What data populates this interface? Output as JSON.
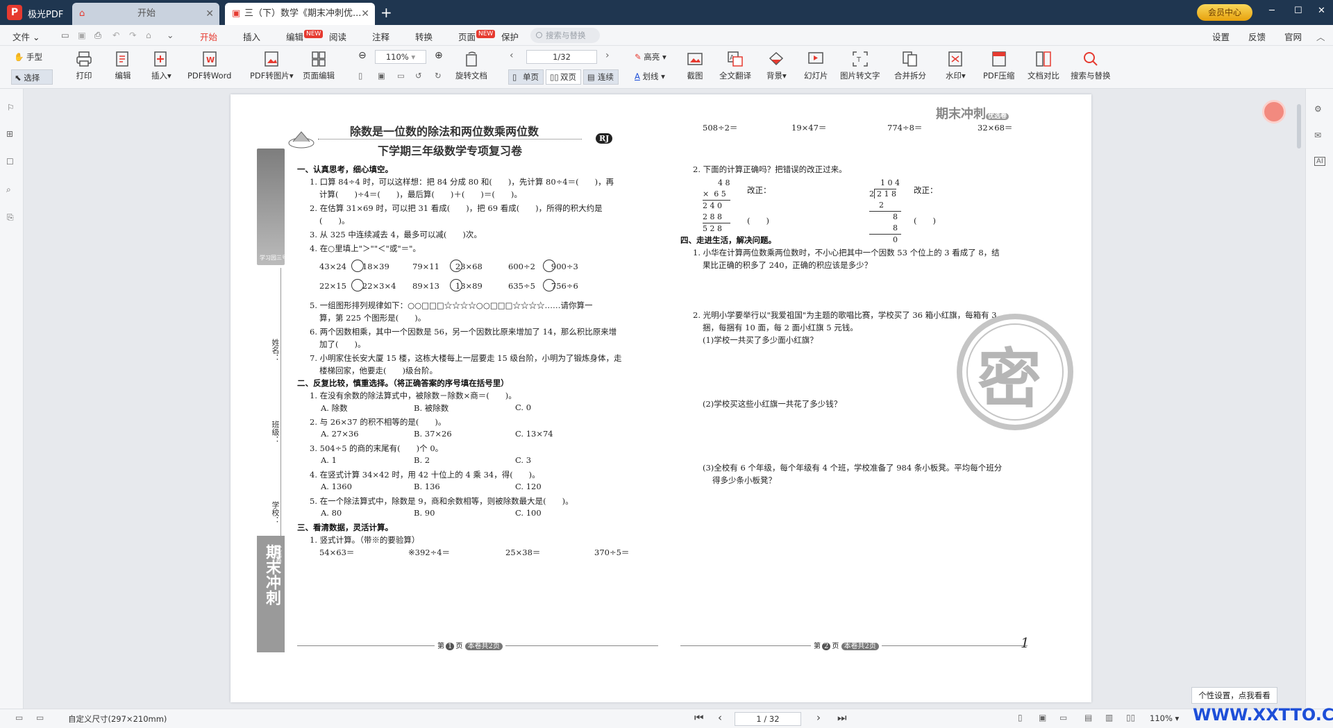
{
  "titlebar": {
    "app_name": "极光PDF",
    "tabs": [
      {
        "label": "开始"
      },
      {
        "label": "三（下）数学《期末冲刺优..."
      }
    ],
    "vip_label": "会员中心"
  },
  "menu": {
    "file": "文件",
    "items": [
      "开始",
      "插入",
      "编辑",
      "阅读",
      "注释",
      "转换",
      "页面",
      "保护"
    ],
    "new_badge": "NEW",
    "search_placeholder": "搜索与替换",
    "right": [
      "设置",
      "反馈",
      "官网"
    ]
  },
  "toolbar": {
    "hand": "手型",
    "select": "选择",
    "print": "打印",
    "edit": "编辑",
    "insert": "插入",
    "pdf2word": "PDF转Word",
    "pdf2img": "PDF转图片",
    "page_edit": "页面编辑",
    "zoom": "110%",
    "rotate": "旋转文档",
    "page": "1/32",
    "single": "单页",
    "double": "双页",
    "continuous": "连续",
    "highlight": "高亮",
    "underline": "划线",
    "screenshot": "截图",
    "translate": "全文翻译",
    "background": "背景",
    "slides": "幻灯片",
    "img2text": "图片转文字",
    "merge": "合并拆分",
    "watermark": "水印",
    "compress": "PDF压缩",
    "compare": "文档对比",
    "search_replace": "搜索与替换"
  },
  "doc": {
    "title1": "除数是一位数的除法和两位数乘两位数",
    "title2": "下学期三年级数学专项复习卷",
    "badge": "RJ",
    "brand_top": "期末冲刺",
    "brand_sub": "优选卷",
    "side_label": "学习园三号",
    "side_name": "姓名：",
    "side_class": "班级：",
    "side_school": "学校：",
    "left": [
      "一、认真思考，细心填空。",
      "1. 口算 84÷4 时，可以这样想：把 84 分成 80 和(　　)，先计算 80÷4＝(　　)，再",
      "计算(　　)÷4＝(　　)，最后算(　　)＋(　　)＝(　　)。",
      "2. 在估算 31×69 时，可以把 31 看成(　　)，把 69 看成(　　)，所得的积大约是",
      "(　　)。",
      "3. 从 325 中连续减去 4，最多可以减(　　)次。",
      "4. 在○里填上\"＞\"\"＜\"或\"＝\"。",
      "43×24　　18×39",
      "79×11　　23×68",
      "600÷2　　900÷3",
      "22×15　　22×3×4",
      "89×13　　13×89",
      "635÷5　　756÷6",
      "5. 一组图形排列规律如下：○○□□□☆☆☆☆○○□□□☆☆☆☆……请你算一",
      "算，第 225 个图形是(　　)。",
      "6. 两个因数相乘，其中一个因数是 56，另一个因数比原来增加了 14，那么积比原来增",
      "加了(　　)。",
      "7. 小明家住长安大厦 15 楼，这栋大楼每上一层要走 15 级台阶，小明为了锻炼身体，走",
      "楼梯回家，他要走(　　)级台阶。",
      "二、反复比较，慎重选择。（将正确答案的序号填在括号里）",
      "1. 在没有余数的除法算式中，被除数－除数×商＝(　　)。",
      "A. 除数",
      "B. 被除数",
      "C. 0",
      "2. 与 26×37 的积不相等的是(　　)。",
      "A. 27×36",
      "B. 37×26",
      "C. 13×74",
      "3. 504÷5 的商的末尾有(　　)个 0。",
      "A. 1",
      "B. 2",
      "C. 3",
      "4. 在竖式计算 34×42 时，用 42 十位上的 4 乘 34，得(　　)。",
      "A. 1360",
      "B. 136",
      "C. 120",
      "5. 在一个除法算式中，除数是 9，商和余数相等，则被除数最大是(　　)。",
      "A. 80",
      "B. 90",
      "C. 100",
      "三、看清数据，灵活计算。",
      "1. 竖式计算。（带※的要验算）",
      "54×63＝",
      "※392÷4＝",
      "25×38＝",
      "370÷5＝"
    ],
    "right": [
      "508÷2＝",
      "19×47＝",
      "774÷8＝",
      "32×68＝",
      "2. 下面的计算正确吗？把错误的改正过来。",
      "改正：",
      "改正：",
      "(　　)",
      "(　　)",
      "四、走进生活，解决问题。",
      "1. 小华在计算两位数乘两位数时，不小心把其中一个因数 53 个位上的 3 看成了 8，结",
      "果比正确的积多了 240，正确的积应该是多少？",
      "2. 光明小学要举行以\"我爱祖国\"为主题的歌唱比赛，学校买了 36 箱小红旗，每箱有 3",
      "捆，每捆有 10 面，每 2 面小红旗 5 元钱。",
      "(1)学校一共买了多少面小红旗？",
      "(2)学校买这些小红旗一共花了多少钱？",
      "(3)全校有 6 个年级，每个年级有 4 个班，学校准备了 984 条小板凳。平均每个班分",
      "得多少条小板凳？"
    ],
    "vert1": [
      "4",
      "8"
    ],
    "vert1b": [
      "×",
      "6",
      "5"
    ],
    "vert1c": [
      "2",
      "4",
      "0"
    ],
    "vert1d": [
      "2",
      "8",
      "8"
    ],
    "vert1e": [
      "5",
      "2",
      "8"
    ],
    "vert2": [
      "1",
      "0",
      "4"
    ],
    "vert2b": [
      "2",
      "1",
      "8"
    ],
    "vert2c": [
      "2"
    ],
    "vert2d": [
      "8"
    ],
    "vert2e": [
      "8"
    ],
    "vert2f": [
      "0"
    ],
    "stamp": "密",
    "footer_left_pre": "第",
    "footer_left_num": "1",
    "footer_left_post": "页",
    "footer_left_tag": "本卷共2页",
    "footer_right_pre": "第",
    "footer_right_num": "2",
    "footer_right_post": "页",
    "footer_right_tag": "本卷共2页",
    "page_mark": "1"
  },
  "status": {
    "size": "自定义尺寸(297×210mm)",
    "page": "1 / 32",
    "zoom": "110%",
    "tip": "个性设置，点我看看",
    "watermark": "WWW.XXTTO.COM"
  }
}
